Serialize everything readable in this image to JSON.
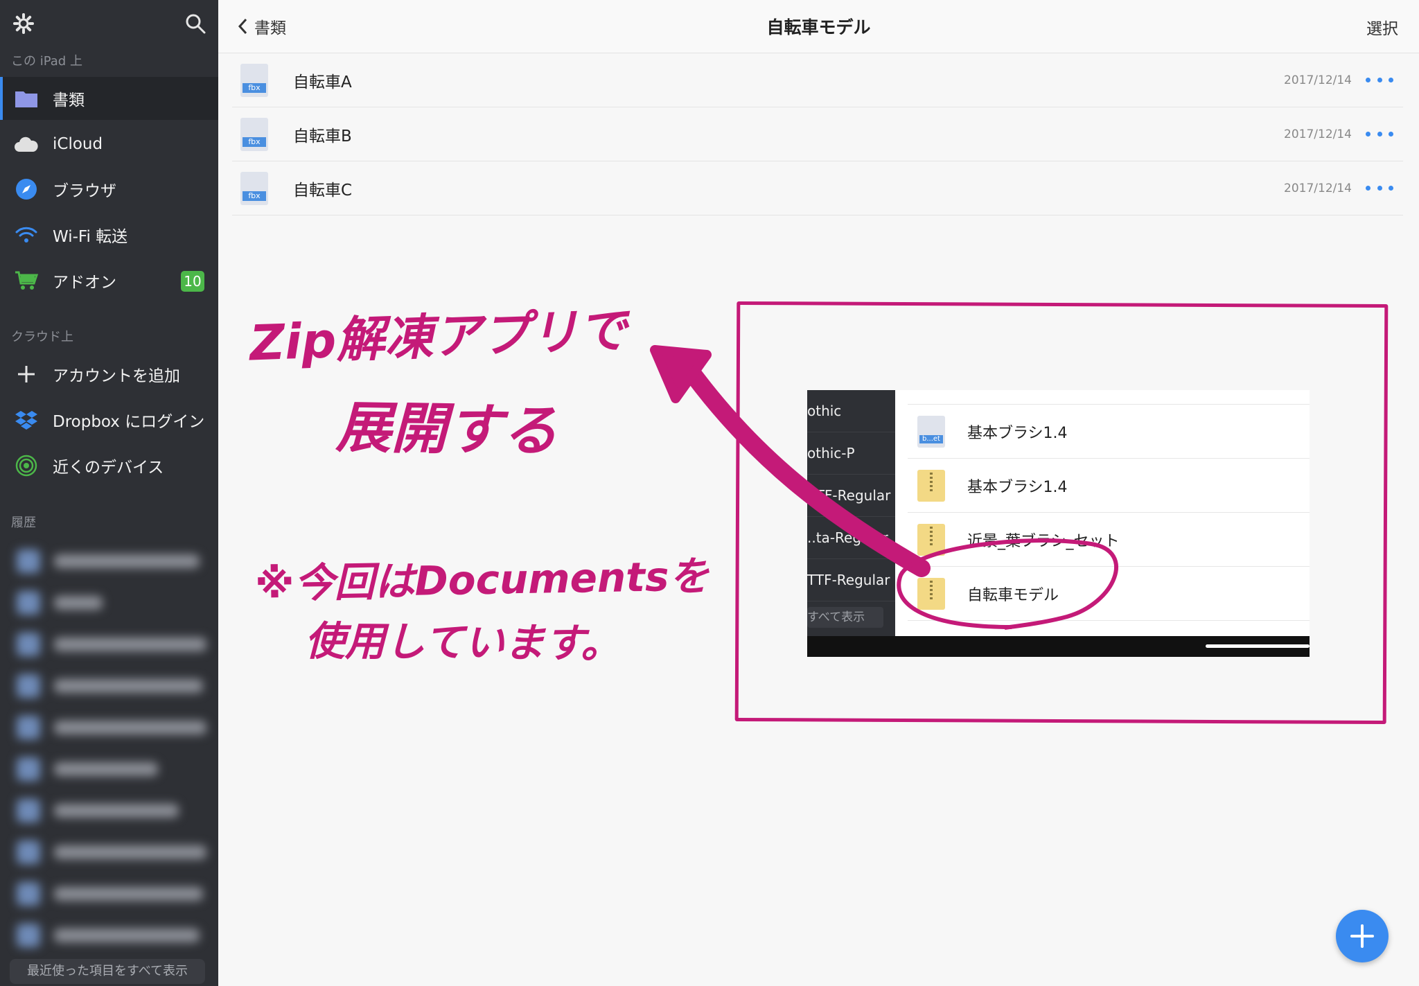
{
  "sidebar": {
    "section_on_ipad": "この iPad 上",
    "section_cloud": "クラウド上",
    "section_history": "履歴",
    "items": [
      {
        "label": "書類",
        "icon": "folder-icon"
      },
      {
        "label": "iCloud",
        "icon": "cloud-icon"
      },
      {
        "label": "ブラウザ",
        "icon": "compass-icon"
      },
      {
        "label": "Wi-Fi 転送",
        "icon": "wifi-icon"
      },
      {
        "label": "アドオン",
        "icon": "cart-icon",
        "badge": "10"
      }
    ],
    "cloud_items": [
      {
        "label": "アカウントを追加",
        "icon": "plus-icon"
      },
      {
        "label": "Dropbox にログイン",
        "icon": "dropbox-icon"
      },
      {
        "label": "近くのデバイス",
        "icon": "nearby-icon"
      }
    ],
    "show_all_recent": "最近使った項目をすべて表示"
  },
  "header": {
    "back_label": "書類",
    "title": "自転車モデル",
    "select_label": "選択"
  },
  "files": [
    {
      "name": "自転車A",
      "date": "2017/12/14",
      "ext": "fbx"
    },
    {
      "name": "自転車B",
      "date": "2017/12/14",
      "ext": "fbx"
    },
    {
      "name": "自転車C",
      "date": "2017/12/14",
      "ext": "fbx"
    }
  ],
  "annotations": {
    "line1": "Zip解凍アプリで",
    "line2": "展開する",
    "note1": "※今回はDocumentsを",
    "note2": "使用しています。",
    "color": "#c41a78"
  },
  "inset": {
    "side_items": [
      "othic",
      "othic-P",
      "..TF-Regular",
      "..ta-Regular",
      "TTF-Regular"
    ],
    "side_show_all": "すべて表示",
    "rows": [
      {
        "name": "基本ブラシ1.4",
        "kind": "b...et"
      },
      {
        "name": "基本ブラシ1.4",
        "kind": "zip"
      },
      {
        "name": "近景_葉ブラシ_セット",
        "kind": "zip"
      },
      {
        "name": "自転車モデル",
        "kind": "zip"
      }
    ]
  },
  "colors": {
    "accent": "#3a8bf0",
    "sidebar_bg": "#2e3035",
    "badge": "#4cb749"
  }
}
